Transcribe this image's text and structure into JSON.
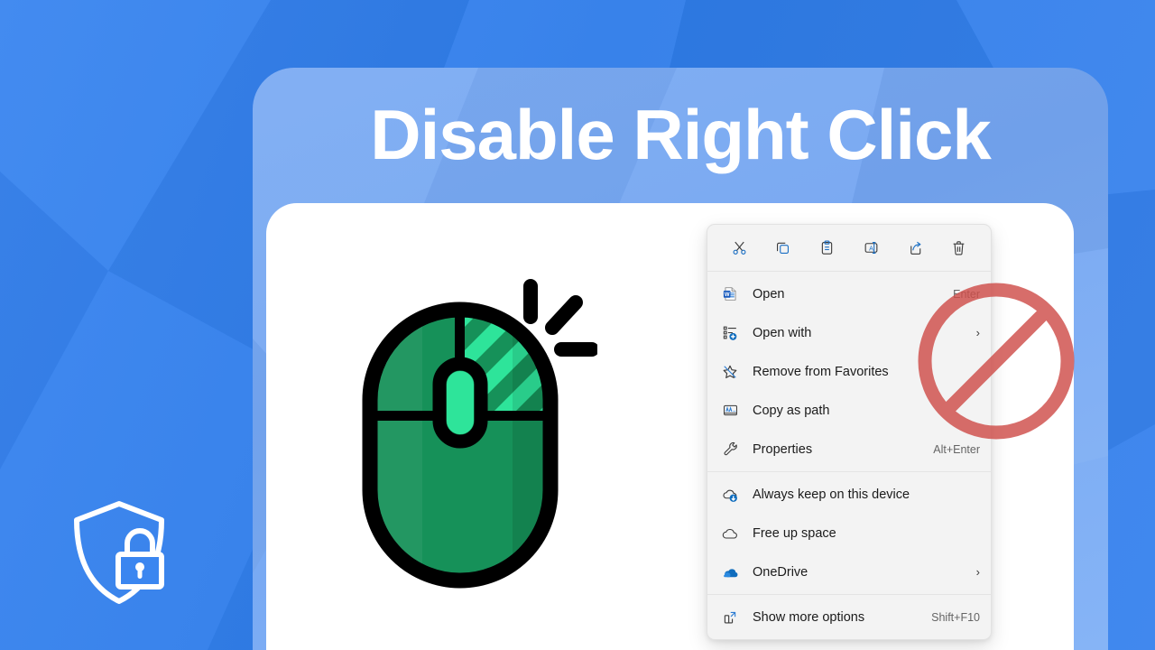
{
  "theme": {
    "bg_blue": "#2f7ded",
    "panel_blue": "#7cabf3",
    "card_white": "#ffffff",
    "menu_bg": "#f3f3f3",
    "accent_blue": "#0f6cbd",
    "mouse_green": "#1a9e63",
    "mouse_green_light": "#2ee49a",
    "ban_red": "#d9534f",
    "title_color": "#ffffff"
  },
  "header": {
    "title": "Disable Right Click"
  },
  "badge": {
    "shield_lock_icon": "shield-lock-icon"
  },
  "illustration": {
    "mouse_icon": "computer-mouse-icon",
    "click_lines_icon": "click-lines-icon"
  },
  "context_menu": {
    "toolbar": [
      {
        "name": "cut-icon",
        "label": "Cut"
      },
      {
        "name": "copy-icon",
        "label": "Copy"
      },
      {
        "name": "paste-icon",
        "label": "Paste"
      },
      {
        "name": "rename-icon",
        "label": "Rename"
      },
      {
        "name": "share-icon",
        "label": "Share"
      },
      {
        "name": "delete-icon",
        "label": "Delete"
      }
    ],
    "groups": [
      {
        "items": [
          {
            "label": "Open",
            "accel": "Enter",
            "arrow": "",
            "icon": "word-document-icon"
          },
          {
            "label": "Open with",
            "accel": "",
            "arrow": "›",
            "icon": "open-with-icon"
          },
          {
            "label": "Remove from Favorites",
            "accel": "",
            "arrow": "",
            "icon": "unfavorite-star-icon"
          },
          {
            "label": "Copy as path",
            "accel": "",
            "arrow": "",
            "icon": "copy-as-path-icon"
          },
          {
            "label": "Properties",
            "accel": "Alt+Enter",
            "arrow": "",
            "icon": "wrench-icon"
          }
        ]
      },
      {
        "items": [
          {
            "label": "Always keep on this device",
            "accel": "",
            "arrow": "",
            "icon": "cloud-download-icon"
          },
          {
            "label": "Free up space",
            "accel": "",
            "arrow": "",
            "icon": "cloud-icon"
          },
          {
            "label": "OneDrive",
            "accel": "",
            "arrow": "›",
            "icon": "onedrive-icon"
          }
        ]
      },
      {
        "items": [
          {
            "label": "Show more options",
            "accel": "Shift+F10",
            "arrow": "",
            "icon": "show-more-options-icon"
          }
        ]
      }
    ]
  },
  "overlay": {
    "ban_icon": "prohibition-sign-icon"
  }
}
